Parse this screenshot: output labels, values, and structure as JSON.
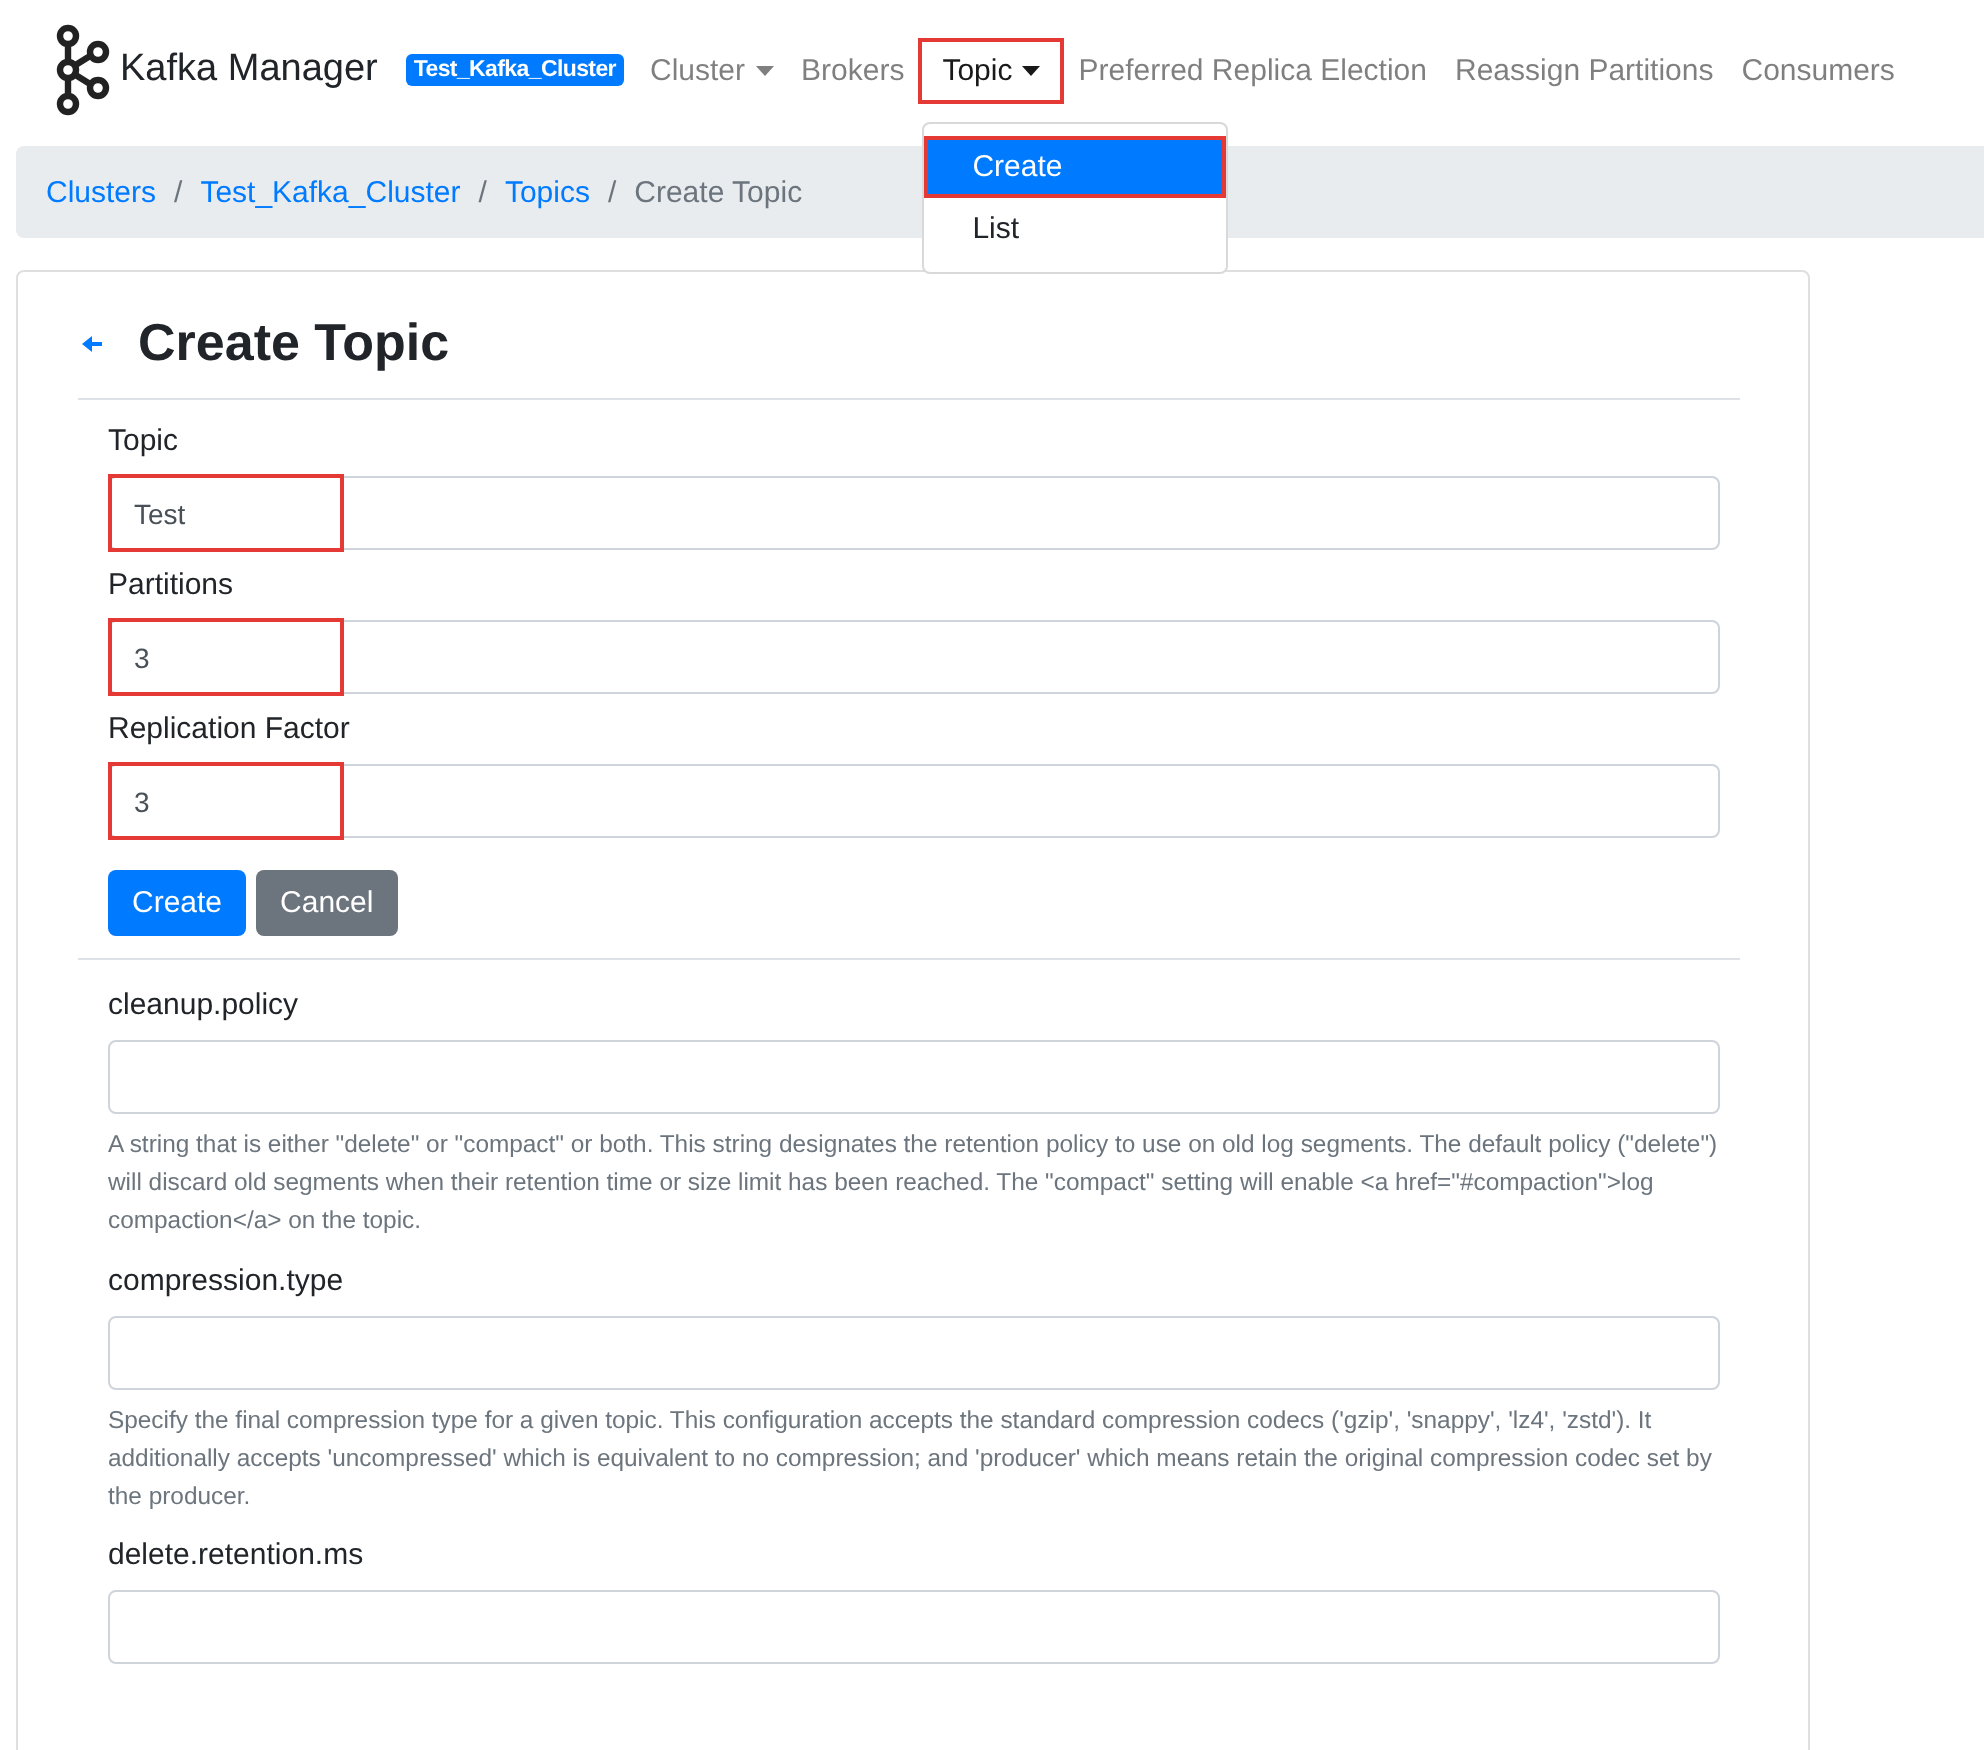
{
  "navbar": {
    "brand": "Kafka Manager",
    "cluster_badge": "Test_Kafka_Cluster",
    "items": [
      {
        "label": "Cluster",
        "dropdown": true,
        "selected": false,
        "highlighted": false
      },
      {
        "label": "Brokers",
        "dropdown": false,
        "selected": false,
        "highlighted": false
      },
      {
        "label": "Topic",
        "dropdown": true,
        "selected": true,
        "highlighted": true
      },
      {
        "label": "Preferred Replica Election",
        "dropdown": false,
        "selected": false,
        "highlighted": false
      },
      {
        "label": "Reassign Partitions",
        "dropdown": false,
        "selected": false,
        "highlighted": false
      },
      {
        "label": "Consumers",
        "dropdown": false,
        "selected": false,
        "highlighted": false
      }
    ],
    "dropdown_menu": [
      {
        "label": "Create",
        "selected": true,
        "highlighted": true
      },
      {
        "label": "List",
        "selected": false,
        "highlighted": false
      }
    ]
  },
  "breadcrumb_separator": "/",
  "breadcrumb": [
    {
      "label": "Clusters",
      "kind": "link"
    },
    {
      "label": "Test_Kafka_Cluster",
      "kind": "link"
    },
    {
      "label": "Topics",
      "kind": "link"
    },
    {
      "label": "Create Topic",
      "kind": "current"
    }
  ],
  "title": "Create Topic",
  "fields": [
    {
      "label": "Topic",
      "value": "Test",
      "highlighted": true
    },
    {
      "label": "Partitions",
      "value": "3",
      "highlighted": true
    },
    {
      "label": "Replication Factor",
      "value": "3",
      "highlighted": true
    }
  ],
  "buttons": [
    {
      "label": "Create",
      "kind": "primary"
    },
    {
      "label": "Cancel",
      "kind": "secondary"
    }
  ],
  "config": [
    {
      "label": "cleanup.policy",
      "help": "A string that is either \"delete\" or \"compact\" or both. This string designates the retention policy to use on old log segments. The default policy (\"delete\") will discard old segments when their retention time or size limit has been reached. The \"compact\" setting will enable <a href=\"#compaction\">log compaction</a> on the topic."
    },
    {
      "label": "compression.type",
      "help": "Specify the final compression type for a given topic. This configuration accepts the standard compression codecs ('gzip', 'snappy', 'lz4', 'zstd'). It additionally accepts 'uncompressed' which is equivalent to no compression; and 'producer' which means retain the original compression codec set by the producer."
    },
    {
      "label": "delete.retention.ms"
    }
  ]
}
